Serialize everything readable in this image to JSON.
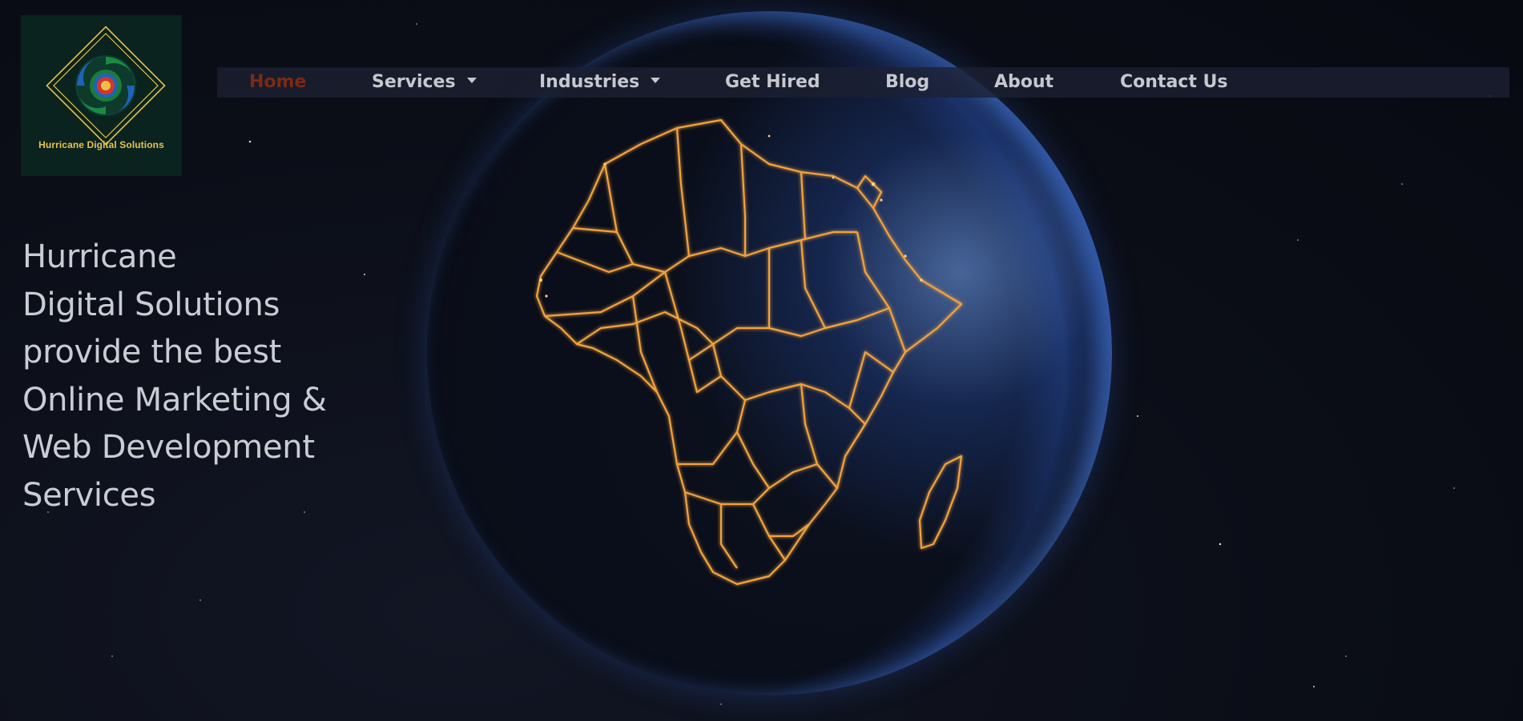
{
  "brand": {
    "logo_caption": "Hurricane Digital Solutions",
    "logo_colors": {
      "background": "#0b231f",
      "diamond": "#e7c24a",
      "swirl_green": "#1a8a45",
      "swirl_blue": "#1e63b8",
      "core_red": "#d8352a"
    }
  },
  "nav": {
    "items": [
      {
        "label": "Home",
        "active": true,
        "dropdown": false
      },
      {
        "label": "Services",
        "active": false,
        "dropdown": true
      },
      {
        "label": "Industries",
        "active": false,
        "dropdown": true
      },
      {
        "label": "Get Hired",
        "active": false,
        "dropdown": false
      },
      {
        "label": "Blog",
        "active": false,
        "dropdown": false
      },
      {
        "label": "About",
        "active": false,
        "dropdown": false
      },
      {
        "label": "Contact Us",
        "active": false,
        "dropdown": false
      }
    ],
    "colors": {
      "active": "#7a2a14",
      "text": "#c6c8cf"
    }
  },
  "hero": {
    "lines": [
      "Hurricane",
      "Digital Solutions",
      "provide the best",
      "Online Marketing &",
      "Web Development",
      "Services"
    ]
  },
  "background": {
    "icon": "earth-africa-night-globe-icon",
    "border_glow_color": "#f2a23c"
  }
}
